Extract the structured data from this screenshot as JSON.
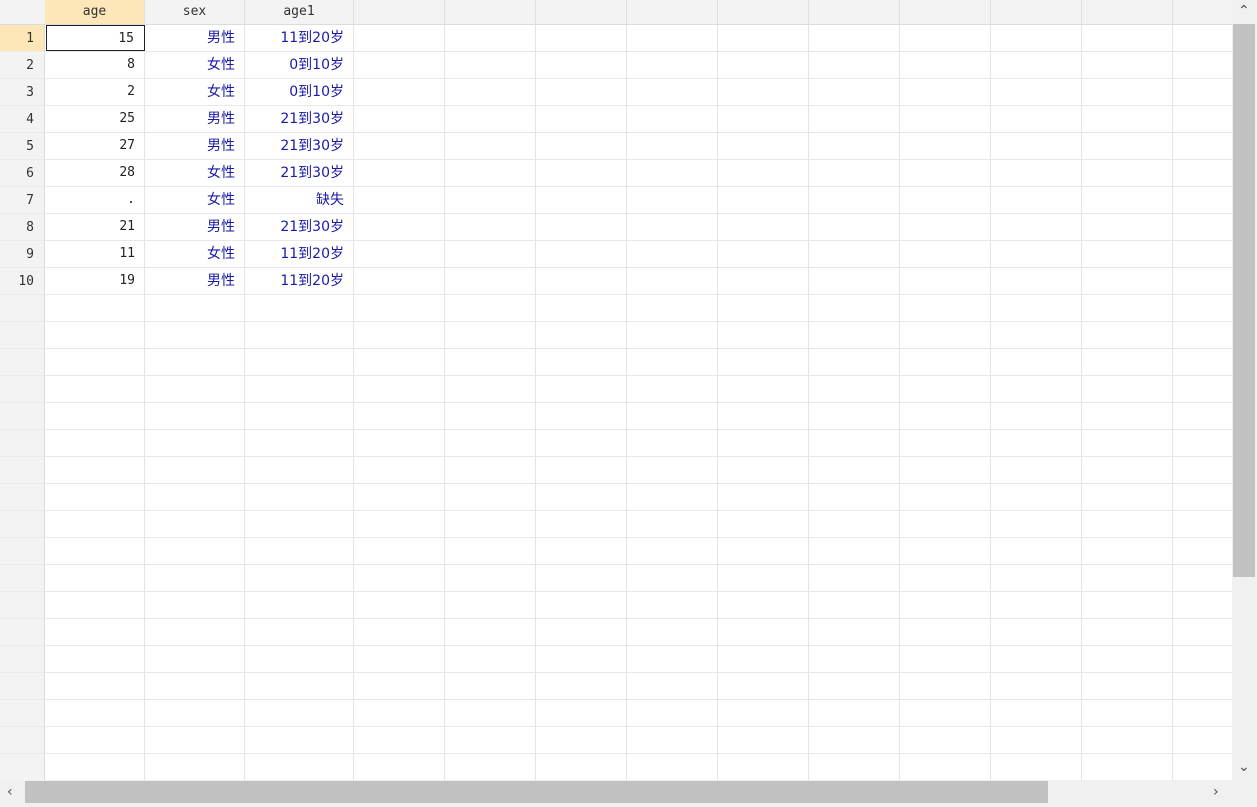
{
  "columns": [
    "age",
    "sex",
    "age1"
  ],
  "rows": [
    {
      "n": "1",
      "age": "15",
      "sex": "男性",
      "age1": "11到20岁"
    },
    {
      "n": "2",
      "age": "8",
      "sex": "女性",
      "age1": "0到10岁"
    },
    {
      "n": "3",
      "age": "2",
      "sex": "女性",
      "age1": "0到10岁"
    },
    {
      "n": "4",
      "age": "25",
      "sex": "男性",
      "age1": "21到30岁"
    },
    {
      "n": "5",
      "age": "27",
      "sex": "男性",
      "age1": "21到30岁"
    },
    {
      "n": "6",
      "age": "28",
      "sex": "女性",
      "age1": "21到30岁"
    },
    {
      "n": "7",
      "age": ".",
      "sex": "女性",
      "age1": "缺失"
    },
    {
      "n": "8",
      "age": "21",
      "sex": "男性",
      "age1": "21到30岁"
    },
    {
      "n": "9",
      "age": "11",
      "sex": "女性",
      "age1": "11到20岁"
    },
    {
      "n": "10",
      "age": "19",
      "sex": "男性",
      "age1": "11到20岁"
    }
  ],
  "selected_cell": {
    "row": "1",
    "column": "age"
  },
  "colors": {
    "label_text": "#1a1aa6",
    "active_header": "#fde6b8"
  },
  "icons": {
    "scroll_up": "chevron-up-icon",
    "scroll_down": "chevron-down-icon",
    "scroll_left": "chevron-left-icon",
    "scroll_right": "chevron-right-icon"
  }
}
